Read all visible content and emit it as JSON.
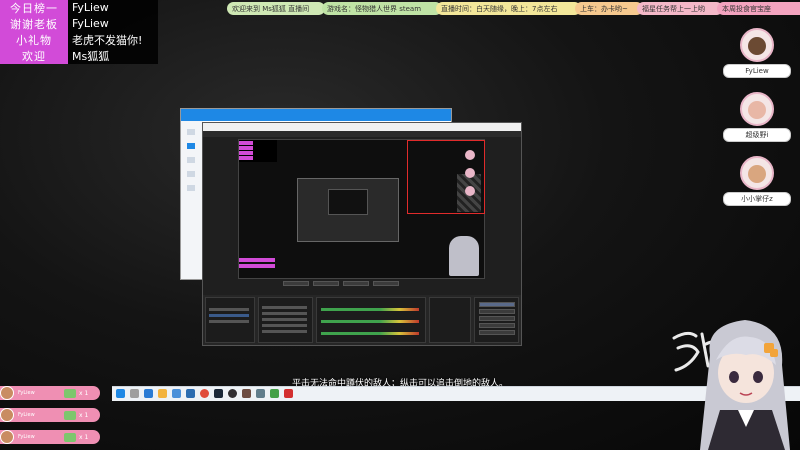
{
  "stats": [
    {
      "key": "今日榜一",
      "value": "FyLiew"
    },
    {
      "key": "谢谢老板",
      "value": "FyLiew"
    },
    {
      "key": "小礼物",
      "value": "老虎不发猫你!"
    },
    {
      "key": "欢迎",
      "value": "Ms狐狐"
    }
  ],
  "ticker": [
    {
      "text": "欢迎来到 Ms狐狐 直播间",
      "color": "#cfe8b4"
    },
    {
      "text": "游戏名：怪物猎人世界 steam",
      "color": "#bfe3a5"
    },
    {
      "text": "直播时间：白天随缘，晚上：7点左右",
      "color": "#f3e79a"
    },
    {
      "text": "上车：办卡哟~",
      "color": "#f6c98f"
    },
    {
      "text": "福星任务帮上一上哟",
      "color": "#f4b8c8"
    },
    {
      "text": "本周投食官宝座",
      "color": "#f3a3bf"
    }
  ],
  "supporters": [
    {
      "name": "FyLiew",
      "face": "#6b4a33"
    },
    {
      "name": "超级野i",
      "face": "#e8b7a6"
    },
    {
      "name": "小小掌仔z",
      "face": "#d9a67f"
    }
  ],
  "subtitle": "平击无法命中蹲伏的敌人；纵击可以追击倒地的敌人。",
  "gifts": [
    {
      "name": "FyLiew",
      "count": "x 1"
    },
    {
      "name": "FyLiew",
      "count": "x 1"
    },
    {
      "name": "FyLiew",
      "count": "x 1"
    }
  ],
  "colors": {
    "accent": "#d24bd8",
    "gift": "#ef8fb3",
    "obs_dark": "#1f1f1f"
  },
  "taskbar_icons": [
    "windows-icon",
    "search-icon",
    "edge-icon",
    "folder-icon",
    "store-icon",
    "mail-icon",
    "chrome-icon",
    "steam-icon",
    "obs-icon",
    "game-icon",
    "settings-icon",
    "chat-icon",
    "video-icon"
  ]
}
